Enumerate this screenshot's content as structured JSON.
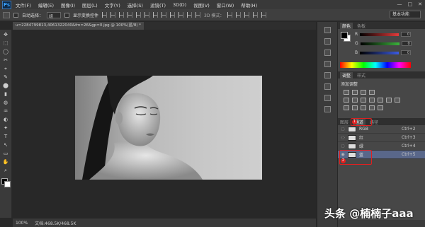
{
  "app": {
    "logo": "Ps"
  },
  "menubar": {
    "items": [
      "文件(F)",
      "编辑(E)",
      "图像(I)",
      "图层(L)",
      "文字(Y)",
      "选择(S)",
      "滤镜(T)",
      "3D(D)",
      "视图(V)",
      "窗口(W)",
      "帮助(H)"
    ],
    "controls": [
      "—",
      "□",
      "✕"
    ]
  },
  "options": {
    "auto_select_label": "自动选择：",
    "auto_select_value": "组",
    "show_transform_label": "显示变换控件",
    "mode_3d_label": "3D 模式：",
    "workspace": "基本功能"
  },
  "document": {
    "tab_title": "u=2284799813,406132204​0&fm=26&gp=0.jpg @ 100%(蓝/8) *",
    "zoom": "100%",
    "doc_info": "文档:468.5K/468.5K"
  },
  "tools": [
    "✥",
    "⬚",
    "◯",
    "✂",
    "⌖",
    "✎",
    "⬤",
    "▮",
    "◍",
    "♒",
    "◐",
    "✦",
    "T",
    "↖",
    "▭",
    "✋",
    "⌕"
  ],
  "color_panel": {
    "tabs": [
      "颜色",
      "色板"
    ],
    "channels": [
      {
        "label": "R",
        "value": "0",
        "color": "#e23b3b"
      },
      {
        "label": "G",
        "value": "0",
        "color": "#3bb23b"
      },
      {
        "label": "B",
        "value": "0",
        "color": "#3b5be2"
      }
    ]
  },
  "adjustments_panel": {
    "tabs": [
      "调整",
      "样式"
    ],
    "title": "添加调整"
  },
  "channels_panel": {
    "tabs": [
      "图层",
      "通道",
      "路径"
    ],
    "rows": [
      {
        "name": "RGB",
        "shortcut": "Ctrl+2",
        "selected": false
      },
      {
        "name": "红",
        "shortcut": "Ctrl+3",
        "selected": false
      },
      {
        "name": "绿",
        "shortcut": "Ctrl+4",
        "selected": false
      },
      {
        "name": "蓝",
        "shortcut": "Ctrl+5",
        "selected": true
      }
    ],
    "step_markers": [
      "1",
      "2"
    ],
    "accent_color": "#e02020"
  },
  "watermark": "头条 @楠楠子aaa"
}
